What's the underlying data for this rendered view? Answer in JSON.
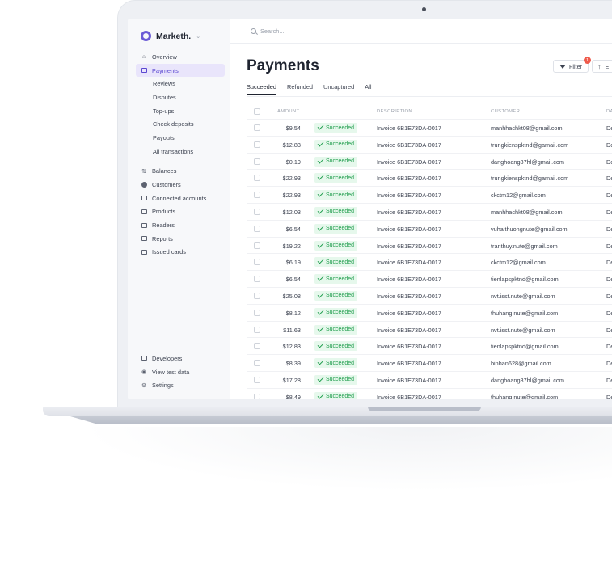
{
  "app": {
    "name": "Marketh."
  },
  "search": {
    "placeholder": "Search..."
  },
  "sidebar": {
    "items": [
      {
        "label": "Overview",
        "icon": "home-icon"
      },
      {
        "label": "Payments",
        "icon": "payments-icon",
        "active": true
      },
      {
        "label": "Reviews",
        "sub": true
      },
      {
        "label": "Disputes",
        "sub": true
      },
      {
        "label": "Top-ups",
        "sub": true
      },
      {
        "label": "Check deposits",
        "sub": true
      },
      {
        "label": "Payouts",
        "sub": true
      },
      {
        "label": "All transactions",
        "sub": true
      },
      {
        "label": "Balances",
        "icon": "balances-icon"
      },
      {
        "label": "Customers",
        "icon": "customers-icon"
      },
      {
        "label": "Connected accounts",
        "icon": "connected-accounts-icon"
      },
      {
        "label": "Products",
        "icon": "products-icon"
      },
      {
        "label": "Readers",
        "icon": "readers-icon"
      },
      {
        "label": "Reports",
        "icon": "reports-icon"
      },
      {
        "label": "Issued cards",
        "icon": "card-icon"
      }
    ],
    "bottom": [
      {
        "label": "Developers",
        "icon": "terminal-icon"
      },
      {
        "label": "View test data",
        "icon": "eye-icon"
      },
      {
        "label": "Settings",
        "icon": "gear-icon"
      }
    ]
  },
  "page": {
    "title": "Payments"
  },
  "toolbar": {
    "filter_label": "Filter",
    "filter_badge": "1",
    "export_label": "E"
  },
  "tabs": [
    "Succeeded",
    "Refunded",
    "Uncaptured",
    "All"
  ],
  "table": {
    "headers": {
      "amount": "AMOUNT",
      "description": "DESCRIPTION",
      "customer": "CUSTOMER",
      "date": "DA"
    },
    "rows": [
      {
        "amount": "$9.54",
        "status": "Succeeded",
        "description": "Invoice 6B1E73DA-0017",
        "customer": "manhhachkt08@gmail.com",
        "date": "De"
      },
      {
        "amount": "$12.83",
        "status": "Succeeded",
        "description": "Invoice 6B1E73DA-0017",
        "customer": "trungkienspktnd@gamail.com",
        "date": "De"
      },
      {
        "amount": "$0.19",
        "status": "Succeeded",
        "description": "Invoice 6B1E73DA-0017",
        "customer": "danghoang87hl@gmail.com",
        "date": "De"
      },
      {
        "amount": "$22.93",
        "status": "Succeeded",
        "description": "Invoice 6B1E73DA-0017",
        "customer": "trungkienspktnd@gamail.com",
        "date": "De"
      },
      {
        "amount": "$22.93",
        "status": "Succeeded",
        "description": "Invoice 6B1E73DA-0017",
        "customer": "ckctm12@gmail.com",
        "date": "De"
      },
      {
        "amount": "$12.03",
        "status": "Succeeded",
        "description": "Invoice 6B1E73DA-0017",
        "customer": "manhhachkt08@gmail.com",
        "date": "De"
      },
      {
        "amount": "$6.54",
        "status": "Succeeded",
        "description": "Invoice 6B1E73DA-0017",
        "customer": "vuhaithuongnute@gmail.com",
        "date": "De"
      },
      {
        "amount": "$19.22",
        "status": "Succeeded",
        "description": "Invoice 6B1E73DA-0017",
        "customer": "tranthuy.nute@gmail.com",
        "date": "De"
      },
      {
        "amount": "$6.19",
        "status": "Succeeded",
        "description": "Invoice 6B1E73DA-0017",
        "customer": "ckctm12@gmail.com",
        "date": "De"
      },
      {
        "amount": "$6.54",
        "status": "Succeeded",
        "description": "Invoice 6B1E73DA-0017",
        "customer": "tienlapspktnd@gmail.com",
        "date": "De"
      },
      {
        "amount": "$25.08",
        "status": "Succeeded",
        "description": "Invoice 6B1E73DA-0017",
        "customer": "nvt.isst.nute@gmail.com",
        "date": "De"
      },
      {
        "amount": "$8.12",
        "status": "Succeeded",
        "description": "Invoice 6B1E73DA-0017",
        "customer": "thuhang.nute@gmail.com",
        "date": "De"
      },
      {
        "amount": "$11.63",
        "status": "Succeeded",
        "description": "Invoice 6B1E73DA-0017",
        "customer": "nvt.isst.nute@gmail.com",
        "date": "De"
      },
      {
        "amount": "$12.83",
        "status": "Succeeded",
        "description": "Invoice 6B1E73DA-0017",
        "customer": "tienlapspktnd@gmail.com",
        "date": "De"
      },
      {
        "amount": "$8.39",
        "status": "Succeeded",
        "description": "Invoice 6B1E73DA-0017",
        "customer": "binhan628@gmail.com",
        "date": "De"
      },
      {
        "amount": "$17.28",
        "status": "Succeeded",
        "description": "Invoice 6B1E73DA-0017",
        "customer": "danghoang87hl@gmail.com",
        "date": "De"
      },
      {
        "amount": "$8.49",
        "status": "Succeeded",
        "description": "Invoice 6B1E73DA-0017",
        "customer": "thuhang.nute@gmail.com",
        "date": "De"
      }
    ]
  },
  "colors": {
    "accent": "#5b48d1",
    "success": "#1f9d4c",
    "success_bg": "#e6f8ec",
    "badge": "#ef5a4b"
  }
}
